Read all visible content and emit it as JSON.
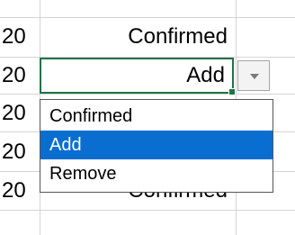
{
  "colors": {
    "active_border": "#217346",
    "selected_option_bg": "#0a6ed1",
    "gridline": "#d4d4d4"
  },
  "rows": [
    {
      "number": "20",
      "status": "Confirmed"
    },
    {
      "number": "20",
      "status": "Add"
    },
    {
      "number": "20",
      "status": ""
    },
    {
      "number": "20",
      "status": ""
    },
    {
      "number": "20",
      "status": "Confirmed"
    }
  ],
  "dropdown": {
    "arrow_icon": "chevron-down-icon",
    "options": [
      "Confirmed",
      "Add",
      "Remove"
    ],
    "selected": "Add"
  }
}
